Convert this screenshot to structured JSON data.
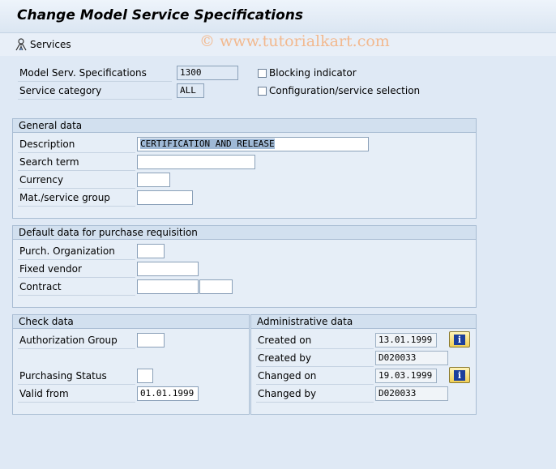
{
  "header": {
    "title": "Change Model Service Specifications"
  },
  "toolbar": {
    "services_label": "Services",
    "watermark": "© www.tutorialkart.com"
  },
  "top": {
    "spec_label": "Model Serv. Specifications",
    "spec_value": "1300",
    "category_label": "Service category",
    "category_value": "ALL",
    "blocking_label": "Blocking indicator",
    "config_label": "Configuration/service selection"
  },
  "general": {
    "title": "General data",
    "description_label": "Description",
    "description_value": "CERTIFICATION AND RELEASE",
    "search_label": "Search term",
    "search_value": "",
    "currency_label": "Currency",
    "currency_value": "",
    "matgroup_label": "Mat./service group",
    "matgroup_value": ""
  },
  "purchase": {
    "title": "Default data for purchase requisition",
    "purch_org_label": "Purch. Organization",
    "purch_org_value": "",
    "vendor_label": "Fixed vendor",
    "vendor_value": "",
    "contract_label": "Contract",
    "contract_value": "",
    "contract_item_value": ""
  },
  "check": {
    "title": "Check data",
    "auth_label": "Authorization Group",
    "auth_value": "",
    "status_label": "Purchasing Status",
    "status_value": "",
    "valid_label": "Valid from",
    "valid_value": "01.01.1999"
  },
  "admin": {
    "title": "Administrative data",
    "created_on_label": "Created on",
    "created_on_value": "13.01.1999",
    "created_by_label": "Created by",
    "created_by_value": "D020033",
    "changed_on_label": "Changed on",
    "changed_on_value": "19.03.1999",
    "changed_by_label": "Changed by",
    "changed_by_value": "D020033",
    "info_glyph": "i"
  },
  "colors": {
    "accent": "#1c3f9c",
    "info_button": "#f1cf55",
    "watermark": "#f2b98f"
  },
  "icons": {
    "services": "services-icon",
    "info": "info-icon"
  }
}
